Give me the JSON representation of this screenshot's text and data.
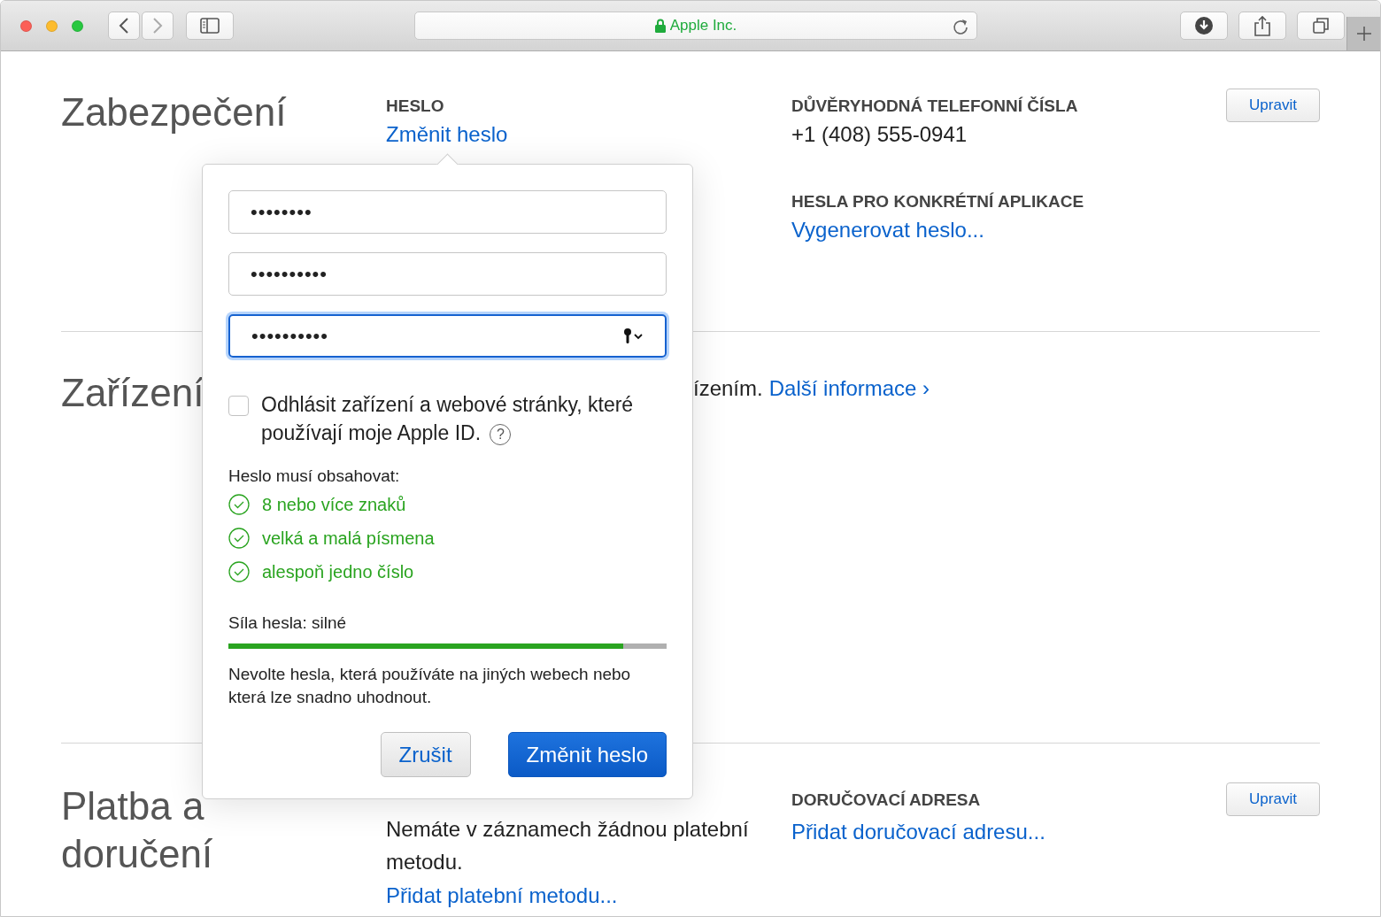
{
  "browser": {
    "address": "Apple Inc.",
    "secure": true
  },
  "security": {
    "title": "Zabezpečení",
    "password": {
      "heading": "HESLO",
      "link": "Změnit heslo"
    },
    "phones": {
      "heading": "DŮVĚRYHODNÁ TELEFONNÍ ČÍSLA",
      "value": "+1 (408) 555-0941"
    },
    "app_passwords": {
      "heading": "HESLA PRO KONKRÉTNÍ APLIKACE",
      "link": "Vygenerovat heslo..."
    },
    "edit_button": "Upravit"
  },
  "devices": {
    "title": "Zařízení",
    "text": "ízením.",
    "link": "Další informace",
    "link_arrow": "›"
  },
  "payment": {
    "title": "Platba a doručení",
    "text": "Nemáte v záznamech žádnou platební metodu.",
    "link": "Přidat platební metodu...",
    "shipping": {
      "heading": "DORUČOVACÍ ADRESA",
      "link": "Přidat doručovací adresu..."
    },
    "edit_button": "Upravit"
  },
  "popover": {
    "fields": [
      {
        "value": "••••••••",
        "focused": false
      },
      {
        "value": "••••••••••",
        "focused": false
      },
      {
        "value": "••••••••••",
        "focused": true
      }
    ],
    "checkbox": {
      "label": "Odhlásit zařízení a webové stránky, které používají moje Apple ID.",
      "checked": false,
      "help": "?"
    },
    "requirements": {
      "title": "Heslo musí obsahovat:",
      "items": [
        {
          "label": "8 nebo více znaků",
          "met": true
        },
        {
          "label": "velká a malá písmena",
          "met": true
        },
        {
          "label": "alespoň jedno číslo",
          "met": true
        }
      ]
    },
    "strength": {
      "label": "Síla hesla: silné",
      "level": 0.9
    },
    "hint": "Nevolte hesla, která používáte na jiných webech nebo která lze snadno uhodnout.",
    "buttons": [
      {
        "label": "Zrušit",
        "kind": "secondary"
      },
      {
        "label": "Změnit heslo",
        "kind": "primary"
      }
    ]
  }
}
